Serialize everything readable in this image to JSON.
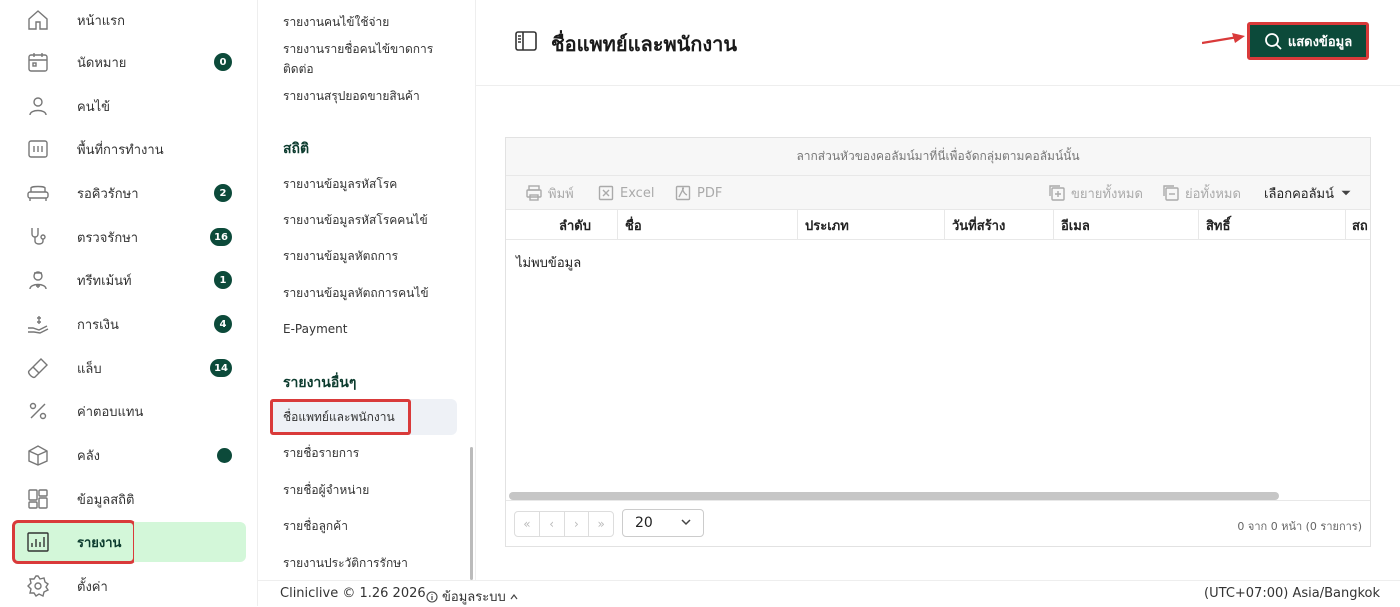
{
  "sidebar": {
    "items": [
      {
        "label": "หน้าแรก",
        "icon": "home-icon",
        "badge": ""
      },
      {
        "label": "นัดหมาย",
        "icon": "calendar-icon",
        "badge": "0"
      },
      {
        "label": "คนไข้",
        "icon": "user-icon",
        "badge": ""
      },
      {
        "label": "พื้นที่การทำงาน",
        "icon": "workspace-icon",
        "badge": ""
      },
      {
        "label": "รอคิวรักษา",
        "icon": "sofa-icon",
        "badge": "2"
      },
      {
        "label": "ตรวจรักษา",
        "icon": "stethoscope-icon",
        "badge": "16"
      },
      {
        "label": "ทรีทเม้นท์",
        "icon": "doctor-icon",
        "badge": "1"
      },
      {
        "label": "การเงิน",
        "icon": "money-hand-icon",
        "badge": "4"
      },
      {
        "label": "แล็บ",
        "icon": "test-tube-icon",
        "badge": "14"
      },
      {
        "label": "ค่าตอบแทน",
        "icon": "percent-icon",
        "badge": ""
      },
      {
        "label": "คลัง",
        "icon": "box-icon",
        "badge": ""
      },
      {
        "label": "ข้อมูลสถิติ",
        "icon": "dashboard-icon",
        "badge": ""
      },
      {
        "label": "รายงาน",
        "icon": "report-chart-icon",
        "badge": ""
      },
      {
        "label": "ตั้งค่า",
        "icon": "gear-icon",
        "badge": ""
      }
    ]
  },
  "submenu": {
    "top_links": [
      "รายงานคนไข้ใช้จ่าย",
      "รายงานรายชื่อคนไข้ขาดการติดต่อ",
      "รายงานสรุปยอดขายสินค้า"
    ],
    "section_stats": "สถิติ",
    "stats_links": [
      "รายงานข้อมูลรหัสโรค",
      "รายงานข้อมูลรหัสโรคคนไข้",
      "รายงานข้อมูลหัตถการ",
      "รายงานข้อมูลหัตถการคนไข้",
      "E-Payment"
    ],
    "section_other": "รายงานอื่นๆ",
    "other_links": [
      "ชื่อแพทย์และพนักงาน",
      "รายชื่อรายการ",
      "รายชื่อผู้จำหน่าย",
      "รายชื่อลูกค้า",
      "รายงานประวัติการรักษา"
    ]
  },
  "main": {
    "title": "ชื่อแพทย์และพนักงาน",
    "show_button": "แสดงข้อมูล",
    "group_hint": "ลากส่วนหัวของคอลัมน์มาที่นี่เพื่อจัดกลุ่มตามคอลัมน์นั้น",
    "toolbar": {
      "print": "พิมพ์",
      "excel": "Excel",
      "pdf": "PDF",
      "expand_all": "ขยายทั้งหมด",
      "collapse_all": "ย่อทั้งหมด",
      "choose_columns": "เลือกคอลัมน์"
    },
    "columns": [
      "ลำดับ",
      "ชื่อ",
      "ประเภท",
      "วันที่สร้าง",
      "อีเมล",
      "สิทธิ์",
      "สถ"
    ],
    "no_data": "ไม่พบข้อมูล",
    "pager": {
      "first": "«",
      "prev": "‹",
      "next": "›",
      "last": "»",
      "page_size": "20",
      "info": "0 จาก 0 หน้า (0 รายการ)"
    }
  },
  "footer": {
    "brand": "Cliniclive © 1.26 2026",
    "system_info": "ข้อมูลระบบ",
    "timezone": "(UTC+07:00) Asia/Bangkok"
  },
  "colors": {
    "accent": "#0c4a3a",
    "active_bg": "#d3f7d9",
    "highlight": "#d93a3a"
  }
}
